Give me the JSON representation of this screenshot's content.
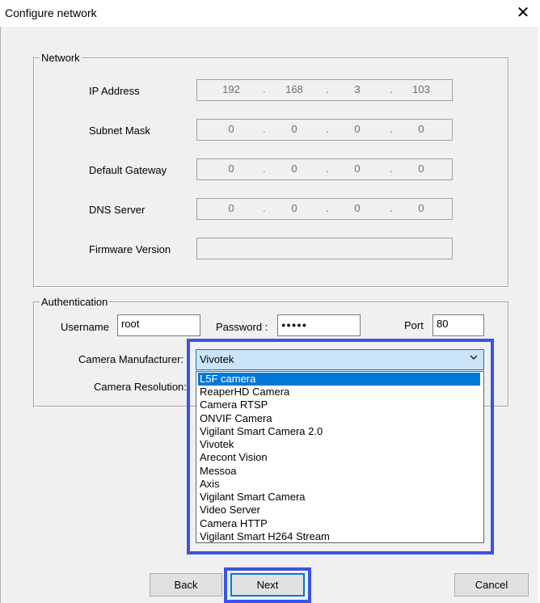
{
  "window": {
    "title": "Configure network",
    "close_glyph": "✕",
    "close_icon": "close-icon"
  },
  "network": {
    "group_label": "Network",
    "ip": {
      "label": "IP Address",
      "octets": [
        "192",
        "168",
        "3",
        "103"
      ]
    },
    "subnet": {
      "label": "Subnet Mask",
      "octets": [
        "0",
        "0",
        "0",
        "0"
      ]
    },
    "gateway": {
      "label": "Default Gateway",
      "octets": [
        "0",
        "0",
        "0",
        "0"
      ]
    },
    "dns": {
      "label": "DNS Server",
      "octets": [
        "0",
        "0",
        "0",
        "0"
      ]
    },
    "firmware": {
      "label": "Firmware Version",
      "value": ""
    }
  },
  "auth": {
    "group_label": "Authentication",
    "username_label": "Username",
    "username_value": "root",
    "password_label": "Password :",
    "password_value": "●●●●●",
    "port_label": "Port",
    "port_value": "80",
    "manufacturer_label": "Camera Manufacturer:",
    "resolution_label": "Camera Resolution:"
  },
  "dropdown": {
    "selected": "Vivotek",
    "chevron_icon": "chevron-down-icon",
    "chevron_glyph": "⌄",
    "options": [
      "L5F camera",
      "ReaperHD Camera",
      "Camera RTSP",
      "ONVIF Camera",
      "Vigilant Smart Camera 2.0",
      "Vivotek",
      "Arecont Vision",
      "Messoa",
      "Axis",
      "Vigilant Smart Camera",
      "Video Server",
      "Camera HTTP",
      "Vigilant Smart H264 Stream"
    ],
    "highlighted_option": "L5F camera"
  },
  "buttons": {
    "back": "Back",
    "next": "Next",
    "cancel": "Cancel"
  },
  "colors": {
    "highlight_frame": "#3b53e6",
    "selection": "#0078d7",
    "dropdown_field": "#cce4f7"
  }
}
